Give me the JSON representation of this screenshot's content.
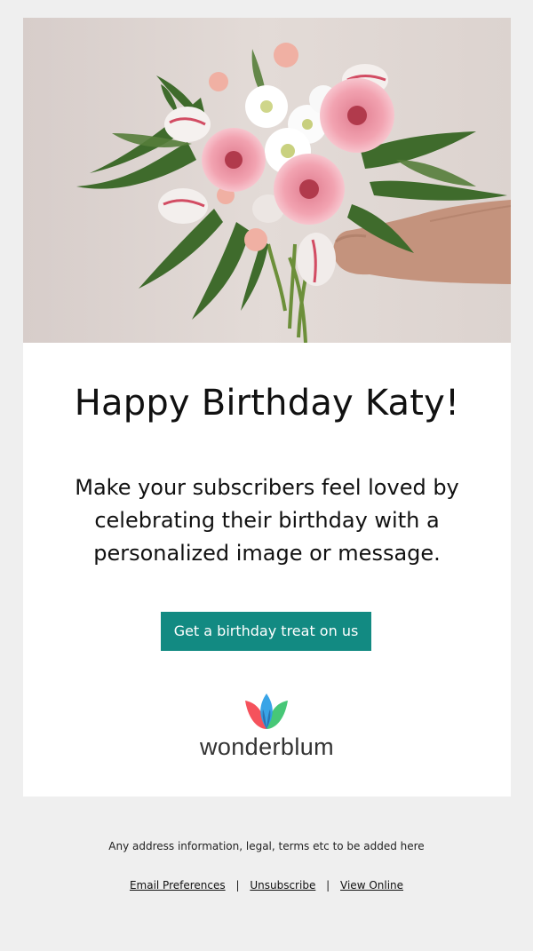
{
  "hero": {
    "image_alt": "bouquet of pink gerbera daisies, white chrysanthemums and tulips held in an outstretched hand"
  },
  "content": {
    "title": "Happy Birthday Katy!",
    "message_lines": [
      "Make your subscribers feel loved by",
      "celebrating their birthday with a",
      "personalized image or message."
    ]
  },
  "cta": {
    "label": "Get a birthday treat on us",
    "color": "#128a82"
  },
  "brand": {
    "name": "wonderblum",
    "colors": [
      "#f5525c",
      "#2e9fe6",
      "#47c777"
    ]
  },
  "footer": {
    "legal": "Any address information, legal, terms etc to be added here",
    "links": [
      "Email Preferences",
      "Unsubscribe",
      "View Online"
    ],
    "separator": "|"
  }
}
